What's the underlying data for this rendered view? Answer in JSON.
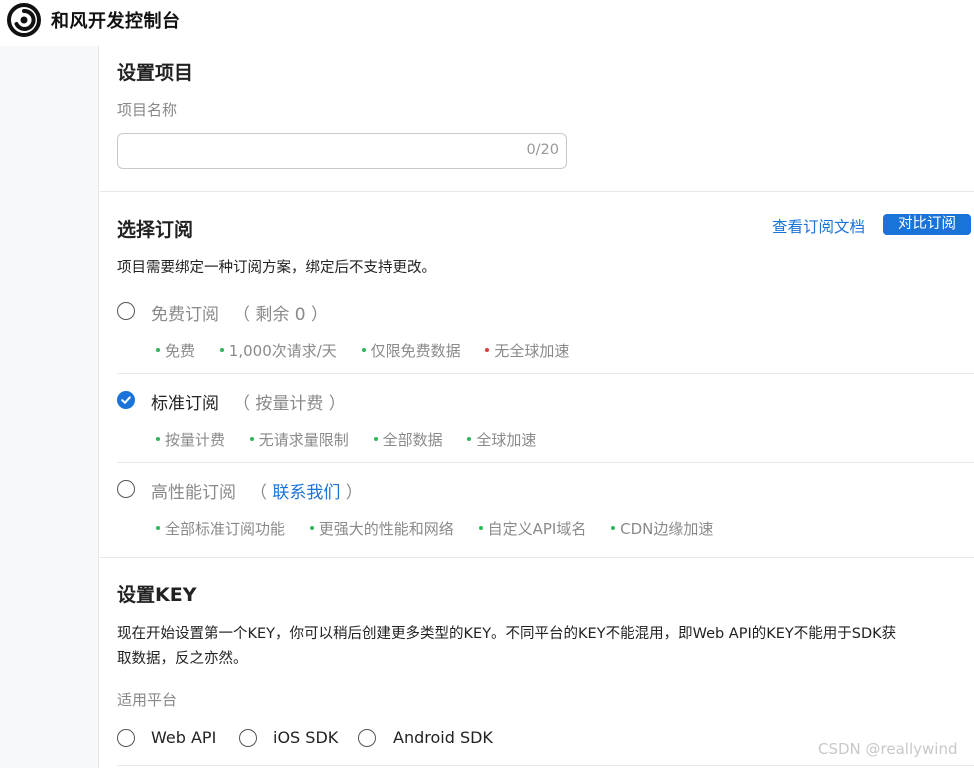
{
  "header": {
    "title": "和风开发控制台",
    "logo_icon": "swirl-logo-icon"
  },
  "project": {
    "section_title": "设置项目",
    "name_label": "项目名称",
    "name_value": "",
    "name_counter": "0/20"
  },
  "subscription": {
    "section_title": "选择订阅",
    "docs_link": "查看订阅文档",
    "compare_button": "对比订阅",
    "description": "项目需要绑定一种订阅方案，绑定后不支持更改。",
    "plans": [
      {
        "name": "免费订阅",
        "note": "（ 剩余 0 ）",
        "selected": false,
        "disabled": true,
        "features": [
          {
            "text": "免费",
            "status": "green"
          },
          {
            "text": "1,000次请求/天",
            "status": "green"
          },
          {
            "text": "仅限免费数据",
            "status": "green"
          },
          {
            "text": "无全球加速",
            "status": "red"
          }
        ]
      },
      {
        "name": "标准订阅",
        "note": "（ 按量计费 ）",
        "selected": true,
        "disabled": false,
        "features": [
          {
            "text": "按量计费",
            "status": "green"
          },
          {
            "text": "无请求量限制",
            "status": "green"
          },
          {
            "text": "全部数据",
            "status": "green"
          },
          {
            "text": "全球加速",
            "status": "green"
          }
        ]
      },
      {
        "name": "高性能订阅",
        "note_open": "（ ",
        "note_link": "联系我们",
        "note_close": " ）",
        "selected": false,
        "disabled": true,
        "features": [
          {
            "text": "全部标准订阅功能",
            "status": "green"
          },
          {
            "text": "更强大的性能和网络",
            "status": "green"
          },
          {
            "text": "自定义API域名",
            "status": "green"
          },
          {
            "text": "CDN边缘加速",
            "status": "green"
          }
        ]
      }
    ]
  },
  "key": {
    "section_title": "设置KEY",
    "description_line1": "现在开始设置第一个KEY，你可以稍后创建更多类型的KEY。不同平台的KEY不能混用，即Web API的KEY不能用于SDK获",
    "description_line2": "取数据，反之亦然。",
    "platform_label": "适用平台",
    "platforms": [
      "Web API",
      "iOS SDK",
      "Android SDK"
    ]
  },
  "watermark": "CSDN @reallywind",
  "colors": {
    "accent": "#1a73d9",
    "feature_ok": "#2fb55b",
    "feature_no": "#e53935"
  }
}
